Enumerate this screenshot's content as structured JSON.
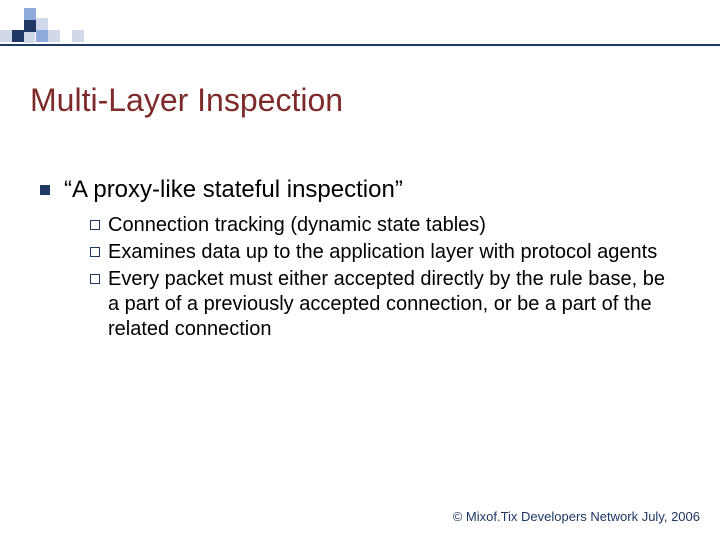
{
  "brand": {
    "accent_dark": "#203864",
    "accent_mid": "#8faadc",
    "accent_light": "#d0d8ea"
  },
  "title": "Multi-Layer Inspection",
  "bullet1": "“A proxy-like stateful inspection”",
  "sub_items": [
    "Connection tracking (dynamic state tables)",
    "Examines data up to the application layer with protocol agents",
    "Every packet must either accepted directly by the rule base, be a part of a previously accepted connection, or be a part of the related connection"
  ],
  "footer": "© Mixof.Tix Developers Network July, 2006"
}
